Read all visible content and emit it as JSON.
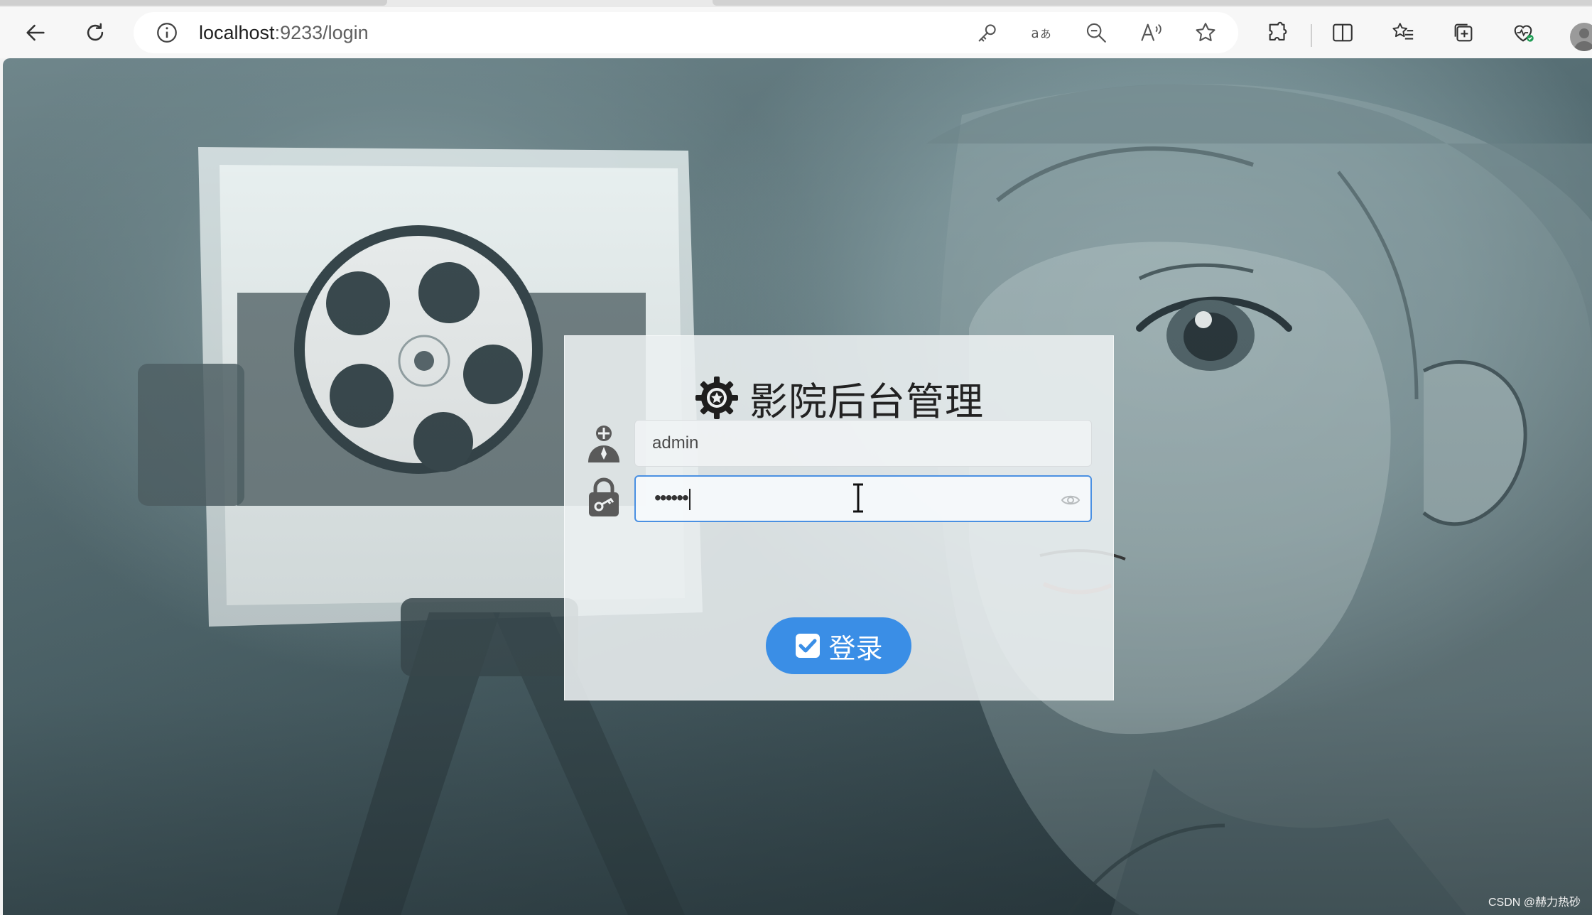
{
  "browser": {
    "url_host": "localhost",
    "url_port_path": ":9233/login",
    "accent": "#3a8ee6",
    "icons": [
      "back-arrow-icon",
      "refresh-icon",
      "site-info-icon",
      "key-icon",
      "translate-icon",
      "zoom-out-icon",
      "read-aloud-icon",
      "favorite-star-icon",
      "extensions-icon",
      "split-screen-icon",
      "favorites-icon",
      "collections-icon",
      "browser-essentials-icon",
      "profile-avatar-icon"
    ]
  },
  "login": {
    "title": "影院后台管理",
    "username_value": "admin",
    "password_mask": "••••••",
    "submit_label": "登录"
  },
  "watermark": "CSDN @赫力热砂"
}
